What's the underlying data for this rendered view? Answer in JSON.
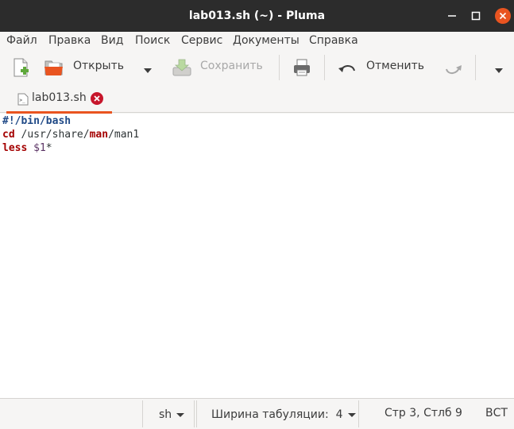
{
  "window": {
    "title": "lab013.sh (~) - Pluma"
  },
  "menu": {
    "items": [
      "Файл",
      "Правка",
      "Вид",
      "Поиск",
      "Сервис",
      "Документы",
      "Справка"
    ]
  },
  "toolbar": {
    "open_label": "Открыть",
    "save_label": "Сохранить",
    "undo_label": "Отменить"
  },
  "tabs": [
    {
      "label": "lab013.sh"
    }
  ],
  "editor": {
    "lines": [
      {
        "parts": [
          {
            "text": "#!/bin/bash",
            "style": "kw-blue"
          }
        ]
      },
      {
        "parts": [
          {
            "text": "cd",
            "style": "kw-red"
          },
          {
            "text": " /",
            "style": ""
          },
          {
            "text": "usr",
            "style": ""
          },
          {
            "text": "/share/",
            "style": ""
          },
          {
            "text": "man",
            "style": "kw-red"
          },
          {
            "text": "/man1",
            "style": ""
          }
        ]
      },
      {
        "parts": [
          {
            "text": "less",
            "style": "kw-red"
          },
          {
            "text": " ",
            "style": ""
          },
          {
            "text": "$1",
            "style": "var"
          },
          {
            "text": "*",
            "style": ""
          }
        ]
      }
    ]
  },
  "statusbar": {
    "language": "sh",
    "tab_width": "Ширина табуляции:  4",
    "position": "Стр 3, Стлб 9",
    "mode": "ВСТ"
  },
  "colors": {
    "accent": "#e95420",
    "titlebar": "#2c2c2c",
    "tab_close": "#c7162b"
  }
}
